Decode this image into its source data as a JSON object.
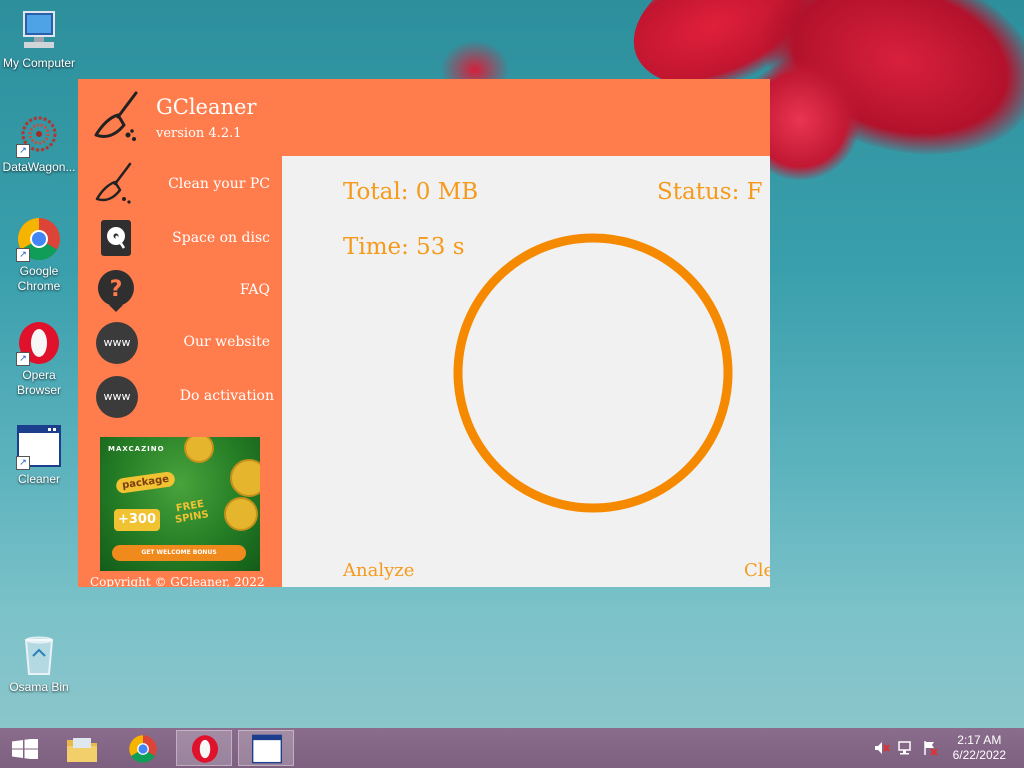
{
  "desktop": {
    "icons": [
      {
        "label": "My Computer",
        "icon": "computer-icon"
      },
      {
        "label": "DataWagon...",
        "icon": "datawagon-icon"
      },
      {
        "label": "Google Chrome",
        "icon": "chrome-icon"
      },
      {
        "label": "Opera Browser",
        "icon": "opera-icon"
      },
      {
        "label": "Cleaner",
        "icon": "window-app-icon"
      },
      {
        "label": "Osama Bin",
        "icon": "recycle-bin-icon"
      }
    ]
  },
  "app": {
    "title": "GCleaner",
    "version": "version 4.2.1",
    "nav": [
      {
        "label": "Clean your PC",
        "icon": "broom-icon"
      },
      {
        "label": "Space on disc",
        "icon": "hard-disk-icon"
      },
      {
        "label": "FAQ",
        "icon": "question-icon"
      },
      {
        "label": "Our website",
        "icon": "www-icon",
        "icon_text": "www"
      },
      {
        "label": "Do activation",
        "icon": "www-icon",
        "icon_text": "www"
      }
    ],
    "ad": {
      "brand": "MAXCAZINO",
      "package": "package",
      "bonus_amount": "+300",
      "free_spins": "FREE SPINS",
      "cta": "GET WELCOME BONUS"
    },
    "copyright": "Copyright © GCleaner, 2022",
    "main": {
      "total": "Total: 0 MB",
      "status": "Status: F",
      "time": "Time: 53 s",
      "analyze_label": "Analyze",
      "clean_label": "Cle"
    },
    "colors": {
      "brand": "#ff7c4c",
      "accent": "#f59a1a",
      "ring": "#f58a00"
    }
  },
  "taskbar": {
    "items": [
      {
        "name": "start",
        "icon": "windows-logo-icon"
      },
      {
        "name": "explorer",
        "icon": "folder-icon"
      },
      {
        "name": "chrome",
        "icon": "chrome-icon"
      },
      {
        "name": "opera",
        "icon": "opera-icon",
        "active": true
      },
      {
        "name": "cleaner",
        "icon": "window-app-icon",
        "active": true
      }
    ],
    "tray": {
      "volume_icon": "speaker-muted-icon",
      "network_icon": "network-icon",
      "flag_icon": "action-center-icon"
    },
    "clock": {
      "time": "2:17 AM",
      "date": "6/22/2022"
    }
  }
}
